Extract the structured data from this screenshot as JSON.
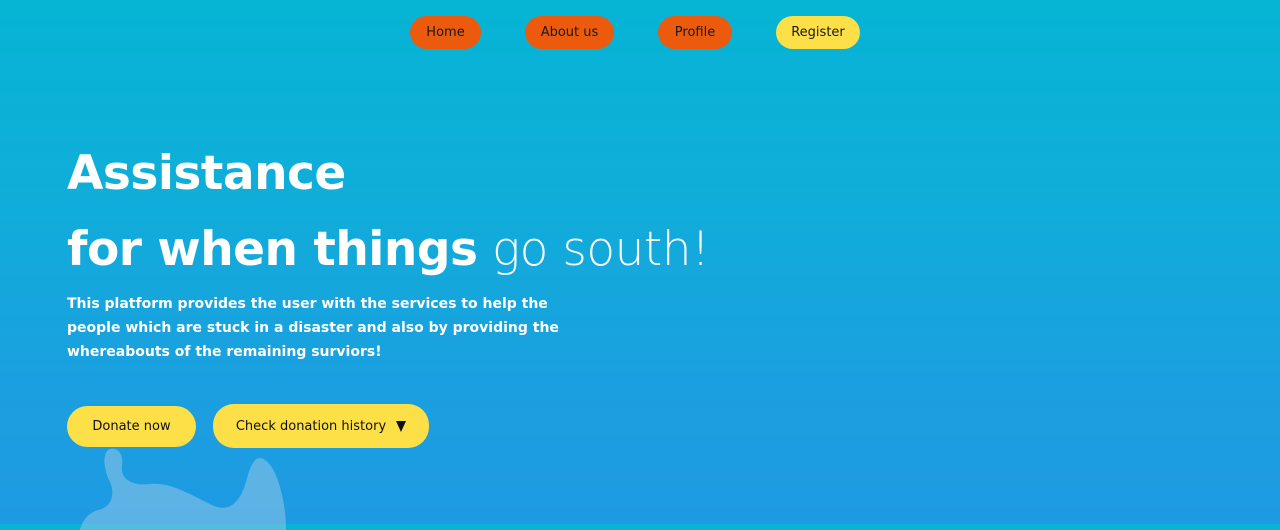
{
  "nav": {
    "items": [
      {
        "label": "Home"
      },
      {
        "label": "About us"
      },
      {
        "label": "Profile"
      },
      {
        "label": "Register"
      }
    ]
  },
  "hero": {
    "heading_line1": "Assistance",
    "heading_line2_bold": "for when things",
    "heading_line2_light": "go south!",
    "description": "This platform provides the user with the services to help the people which are stuck in a disaster and also by providing the whereabouts of the remaining surviors!"
  },
  "actions": {
    "donate_label": "Donate now",
    "history_label": "Check donation history"
  },
  "colors": {
    "background_top": "#06b4d4",
    "background_bottom": "#1e9ae2",
    "nav_orange": "#ec5a0e",
    "accent_yellow": "#fde047"
  },
  "icons": {
    "caret": "caret-down-icon",
    "decoration": "illustration-shape"
  }
}
